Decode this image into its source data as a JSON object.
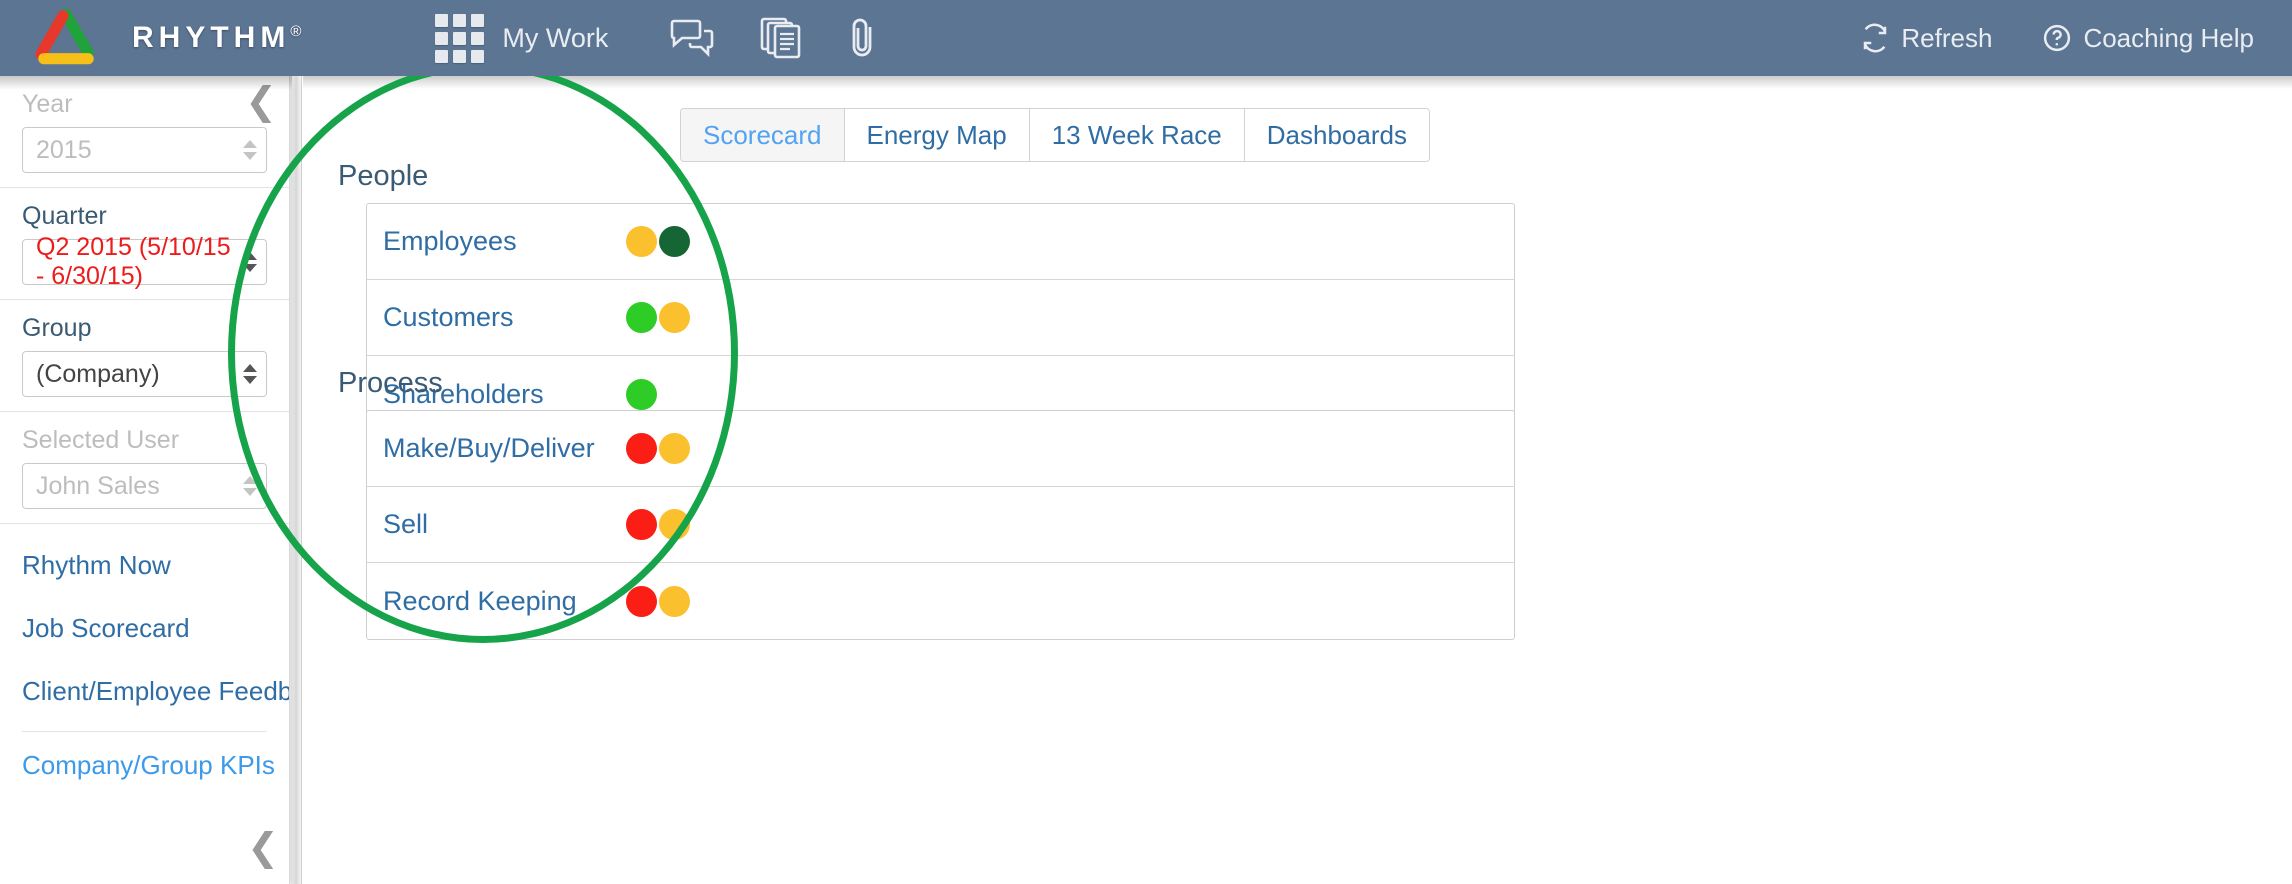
{
  "header": {
    "brand": "RHYTHM",
    "brand_registered": "®",
    "logo_icon": "rhythm-triangle-logo",
    "apps_icon": "grid-apps-icon",
    "my_work_label": "My Work",
    "icons": [
      {
        "name": "chat-bubbles-icon",
        "label": "Discussions"
      },
      {
        "name": "documents-copy-icon",
        "label": "Documents"
      },
      {
        "name": "paperclip-icon",
        "label": "Attachments"
      }
    ],
    "refresh_label": "Refresh",
    "refresh_icon": "refresh-icon",
    "coaching_help_label": "Coaching Help",
    "coaching_help_icon": "question-circle-icon",
    "background_color": "#5b7593"
  },
  "sidebar": {
    "collapse_top_icon": "chevron-left-icon",
    "collapse_bottom_icon": "chevron-left-icon",
    "filters": [
      {
        "label": "Year",
        "value": "2015",
        "disabled": true,
        "value_color": "#bdbdbd"
      },
      {
        "label": "Quarter",
        "value": "Q2 2015 (5/10/15 - 6/30/15)",
        "disabled": false,
        "value_color": "#ee1b1b"
      },
      {
        "label": "Group",
        "value": "(Company)",
        "disabled": false,
        "value_color": "#444444"
      },
      {
        "label": "Selected User",
        "value": "John Sales",
        "disabled": true,
        "value_color": "#bdbdbd"
      }
    ],
    "links": [
      {
        "label": "Rhythm Now",
        "active": false
      },
      {
        "label": "Job Scorecard",
        "active": false
      },
      {
        "label": "Client/Employee Feedback",
        "active": false
      }
    ],
    "links_secondary": [
      {
        "label": "Company/Group KPIs",
        "active": true
      }
    ]
  },
  "main": {
    "tabs": [
      {
        "label": "Scorecard",
        "active": true
      },
      {
        "label": "Energy Map",
        "active": false
      },
      {
        "label": "13 Week Race",
        "active": false
      },
      {
        "label": "Dashboards",
        "active": false
      }
    ],
    "sections": [
      {
        "title": "People",
        "rows": [
          {
            "label": "Employees",
            "dots": [
              "#fbc02d",
              "#166534"
            ]
          },
          {
            "label": "Customers",
            "dots": [
              "#2ecc27",
              "#fbc02d"
            ]
          },
          {
            "label": "Shareholders",
            "dots": [
              "#2ecc27"
            ]
          }
        ]
      },
      {
        "title": "Process",
        "rows": [
          {
            "label": "Make/Buy/Deliver",
            "dots": [
              "#fa1e14",
              "#fbc02d"
            ]
          },
          {
            "label": "Sell",
            "dots": [
              "#fa1e14",
              "#fbc02d"
            ]
          },
          {
            "label": "Record Keeping",
            "dots": [
              "#fa1e14",
              "#fbc02d"
            ]
          }
        ]
      }
    ]
  },
  "annotation": {
    "highlight_circle_color": "#16a34a"
  }
}
